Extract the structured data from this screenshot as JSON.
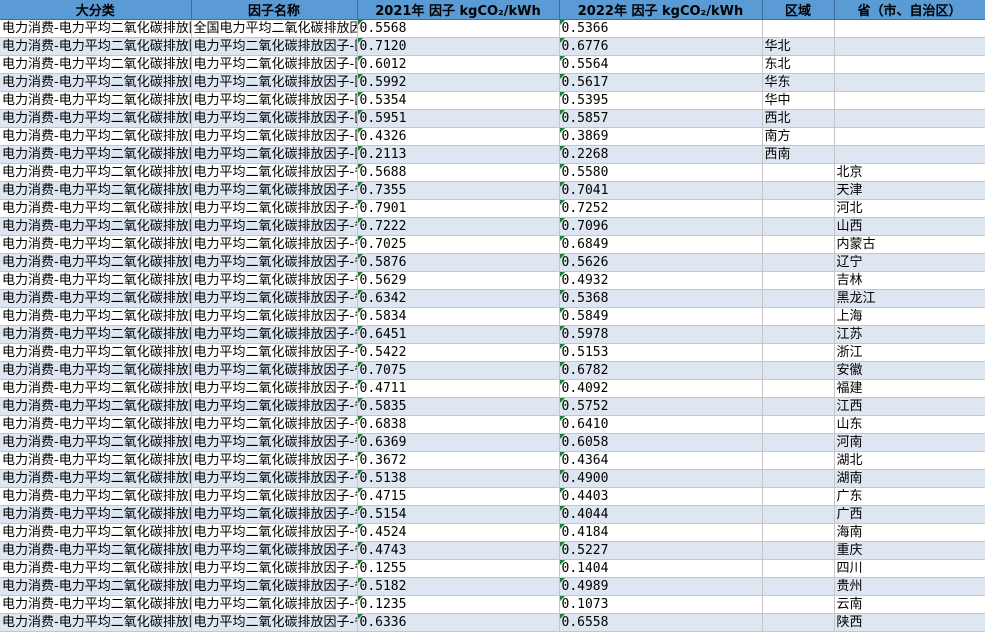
{
  "columns": {
    "category": "大分类",
    "factor_name": "因子名称",
    "y2021": "2021年 因子 kgCO₂/kWh",
    "y2022": "2022年 因子 kgCO₂/kWh",
    "region": "区域",
    "province": "省（市、自治区）"
  },
  "category_text": "电力消费-电力平均二氧化碳排放因子-",
  "rows": [
    {
      "name": "全国电力平均二氧化碳排放因子",
      "v2021": "0.5568",
      "v2022": "0.5366",
      "region": "",
      "province": ""
    },
    {
      "name": "电力平均二氧化碳排放因子-区域电力平均二氧化碳排放因子",
      "v2021": "0.7120",
      "v2022": "0.6776",
      "region": "华北",
      "province": ""
    },
    {
      "name": "电力平均二氧化碳排放因子-区域电力平均二氧化碳排放因子",
      "v2021": "0.6012",
      "v2022": "0.5564",
      "region": "东北",
      "province": ""
    },
    {
      "name": "电力平均二氧化碳排放因子-区域电力平均二氧化碳排放因子",
      "v2021": "0.5992",
      "v2022": "0.5617",
      "region": "华东",
      "province": ""
    },
    {
      "name": "电力平均二氧化碳排放因子-区域电力平均二氧化碳排放因子",
      "v2021": "0.5354",
      "v2022": "0.5395",
      "region": "华中",
      "province": ""
    },
    {
      "name": "电力平均二氧化碳排放因子-区域电力平均二氧化碳排放因子",
      "v2021": "0.5951",
      "v2022": "0.5857",
      "region": "西北",
      "province": ""
    },
    {
      "name": "电力平均二氧化碳排放因子-区域电力平均二氧化碳排放因子",
      "v2021": "0.4326",
      "v2022": "0.3869",
      "region": "南方",
      "province": ""
    },
    {
      "name": "电力平均二氧化碳排放因子-区域电力平均二氧化碳排放因子",
      "v2021": "0.2113",
      "v2022": "0.2268",
      "region": "西南",
      "province": ""
    },
    {
      "name": "电力平均二氧化碳排放因子-省级电力平均二氧化碳排放因子",
      "v2021": "0.5688",
      "v2022": "0.5580",
      "region": "",
      "province": "北京"
    },
    {
      "name": "电力平均二氧化碳排放因子-省级电力平均二氧化碳排放因子",
      "v2021": "0.7355",
      "v2022": "0.7041",
      "region": "",
      "province": "天津"
    },
    {
      "name": "电力平均二氧化碳排放因子-省级电力平均二氧化碳排放因子",
      "v2021": "0.7901",
      "v2022": "0.7252",
      "region": "",
      "province": "河北"
    },
    {
      "name": "电力平均二氧化碳排放因子-省级电力平均二氧化碳排放因子",
      "v2021": "0.7222",
      "v2022": "0.7096",
      "region": "",
      "province": "山西"
    },
    {
      "name": "电力平均二氧化碳排放因子-省级电力平均二氧化碳排放因子",
      "v2021": "0.7025",
      "v2022": "0.6849",
      "region": "",
      "province": "内蒙古"
    },
    {
      "name": "电力平均二氧化碳排放因子-省级电力平均二氧化碳排放因子",
      "v2021": "0.5876",
      "v2022": "0.5626",
      "region": "",
      "province": "辽宁"
    },
    {
      "name": "电力平均二氧化碳排放因子-省级电力平均二氧化碳排放因子",
      "v2021": "0.5629",
      "v2022": "0.4932",
      "region": "",
      "province": "吉林"
    },
    {
      "name": "电力平均二氧化碳排放因子-省级电力平均二氧化碳排放因子",
      "v2021": "0.6342",
      "v2022": "0.5368",
      "region": "",
      "province": "黑龙江"
    },
    {
      "name": "电力平均二氧化碳排放因子-省级电力平均二氧化碳排放因子",
      "v2021": "0.5834",
      "v2022": "0.5849",
      "region": "",
      "province": "上海"
    },
    {
      "name": "电力平均二氧化碳排放因子-省级电力平均二氧化碳排放因子",
      "v2021": "0.6451",
      "v2022": "0.5978",
      "region": "",
      "province": "江苏"
    },
    {
      "name": "电力平均二氧化碳排放因子-省级电力平均二氧化碳排放因子",
      "v2021": "0.5422",
      "v2022": "0.5153",
      "region": "",
      "province": "浙江"
    },
    {
      "name": "电力平均二氧化碳排放因子-省级电力平均二氧化碳排放因子",
      "v2021": "0.7075",
      "v2022": "0.6782",
      "region": "",
      "province": "安徽"
    },
    {
      "name": "电力平均二氧化碳排放因子-省级电力平均二氧化碳排放因子",
      "v2021": "0.4711",
      "v2022": "0.4092",
      "region": "",
      "province": "福建"
    },
    {
      "name": "电力平均二氧化碳排放因子-省级电力平均二氧化碳排放因子",
      "v2021": "0.5835",
      "v2022": "0.5752",
      "region": "",
      "province": "江西"
    },
    {
      "name": "电力平均二氧化碳排放因子-省级电力平均二氧化碳排放因子",
      "v2021": "0.6838",
      "v2022": "0.6410",
      "region": "",
      "province": "山东"
    },
    {
      "name": "电力平均二氧化碳排放因子-省级电力平均二氧化碳排放因子",
      "v2021": "0.6369",
      "v2022": "0.6058",
      "region": "",
      "province": "河南"
    },
    {
      "name": "电力平均二氧化碳排放因子-省级电力平均二氧化碳排放因子",
      "v2021": "0.3672",
      "v2022": "0.4364",
      "region": "",
      "province": "湖北"
    },
    {
      "name": "电力平均二氧化碳排放因子-省级电力平均二氧化碳排放因子",
      "v2021": "0.5138",
      "v2022": "0.4900",
      "region": "",
      "province": "湖南"
    },
    {
      "name": "电力平均二氧化碳排放因子-省级电力平均二氧化碳排放因子",
      "v2021": "0.4715",
      "v2022": "0.4403",
      "region": "",
      "province": "广东"
    },
    {
      "name": "电力平均二氧化碳排放因子-省级电力平均二氧化碳排放因子",
      "v2021": "0.5154",
      "v2022": "0.4044",
      "region": "",
      "province": "广西"
    },
    {
      "name": "电力平均二氧化碳排放因子-省级电力平均二氧化碳排放因子",
      "v2021": "0.4524",
      "v2022": "0.4184",
      "region": "",
      "province": "海南"
    },
    {
      "name": "电力平均二氧化碳排放因子-省级电力平均二氧化碳排放因子",
      "v2021": "0.4743",
      "v2022": "0.5227",
      "region": "",
      "province": "重庆"
    },
    {
      "name": "电力平均二氧化碳排放因子-省级电力平均二氧化碳排放因子",
      "v2021": "0.1255",
      "v2022": "0.1404",
      "region": "",
      "province": "四川"
    },
    {
      "name": "电力平均二氧化碳排放因子-省级电力平均二氧化碳排放因子",
      "v2021": "0.5182",
      "v2022": "0.4989",
      "region": "",
      "province": "贵州"
    },
    {
      "name": "电力平均二氧化碳排放因子-省级电力平均二氧化碳排放因子",
      "v2021": "0.1235",
      "v2022": "0.1073",
      "region": "",
      "province": "云南"
    },
    {
      "name": "电力平均二氧化碳排放因子-省级电力平均二氧化碳排放因子",
      "v2021": "0.6336",
      "v2022": "0.6558",
      "region": "",
      "province": "陕西"
    }
  ]
}
